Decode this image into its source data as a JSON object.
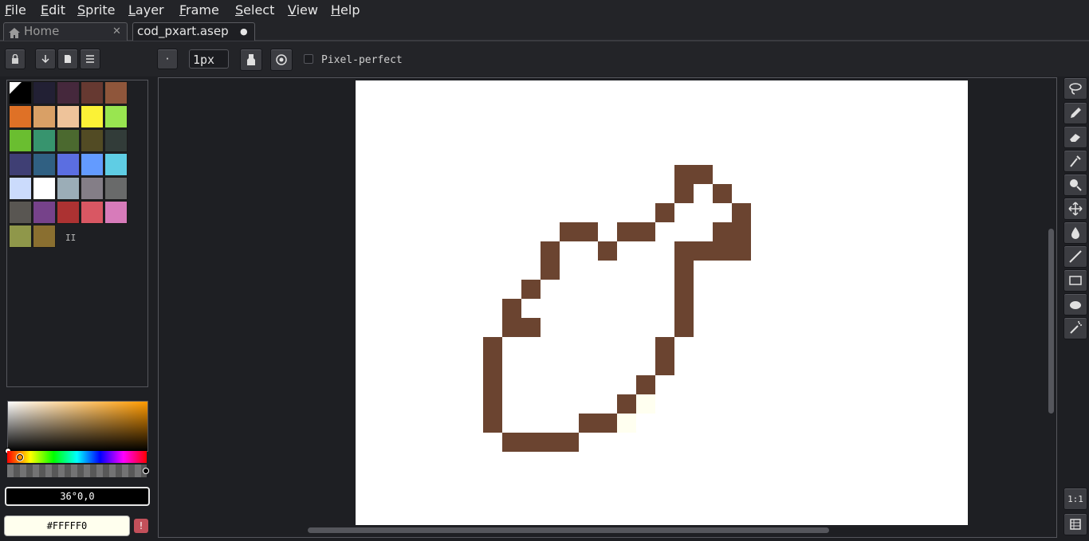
{
  "menu": [
    "File",
    "Edit",
    "Sprite",
    "Layer",
    "Frame",
    "Select",
    "View",
    "Help"
  ],
  "tabs": {
    "home": {
      "label": "Home",
      "close": "✕"
    },
    "file": {
      "label": "cod_pxart.asep",
      "modified_dot": "●"
    }
  },
  "toolbar": {
    "brush_shape_label": "·",
    "pen_size": "1px",
    "pixel_perfect_label": "Pixel-perfect",
    "pixel_perfect_checked": false
  },
  "palette": {
    "colors": [
      "#000000",
      "#222034",
      "#45283c",
      "#663931",
      "#8f563b",
      "#df7126",
      "#d9a066",
      "#eec39a",
      "#fbf236",
      "#99e550",
      "#6abe30",
      "#37946e",
      "#4b692f",
      "#524b24",
      "#323c39",
      "#3f3f74",
      "#306082",
      "#5b6ee1",
      "#639bff",
      "#5fcde4",
      "#cbdbfc",
      "#ffffff",
      "#9badb7",
      "#847e87",
      "#696a6a",
      "#595652",
      "#76428a",
      "#ac3232",
      "#d95763",
      "#d77bba",
      "#8f974a",
      "#8a6f30"
    ],
    "resize_handle": "II"
  },
  "color_picker": {
    "hsv_text": "36°0,0",
    "hex_text": "#FFFFF0",
    "warning_icon": "!"
  },
  "sprite": {
    "stroke_color": "#6b4430",
    "pale_color": "#fffff0",
    "cell_size_px": 24
  },
  "right_tools": [
    "lasso-icon",
    "pencil-icon",
    "eraser-icon",
    "eyedropper-icon",
    "zoom-icon",
    "move-icon",
    "fill-icon",
    "line-icon",
    "rectangle-icon",
    "blob-icon",
    "spray-icon"
  ],
  "bottom_tools": {
    "one_to_one": "1:1",
    "timeline": "timeline-icon"
  }
}
